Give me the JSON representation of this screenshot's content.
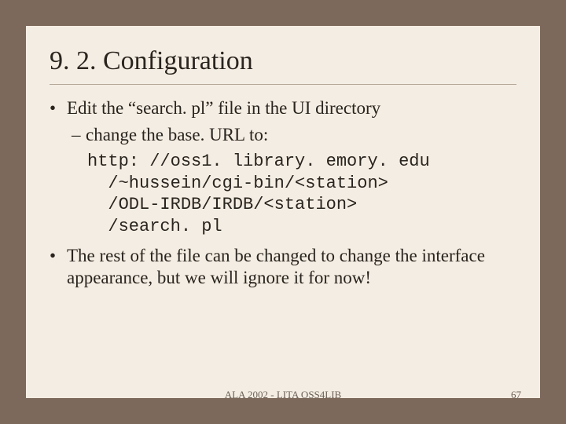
{
  "title": "9. 2. Configuration",
  "bullets": {
    "b1": "Edit the “search. pl” file in the UI directory",
    "s1": "change the base. URL to:",
    "code": "http: //oss1. library. emory. edu\n  /~hussein/cgi-bin/<station>\n  /ODL-IRDB/IRDB/<station>\n  /search. pl",
    "b2": "The rest of the file can be changed to change the interface appearance, but we will ignore it for now!"
  },
  "footer": {
    "center": "ALA 2002 - LITA OSS4LIB",
    "page": "67"
  }
}
